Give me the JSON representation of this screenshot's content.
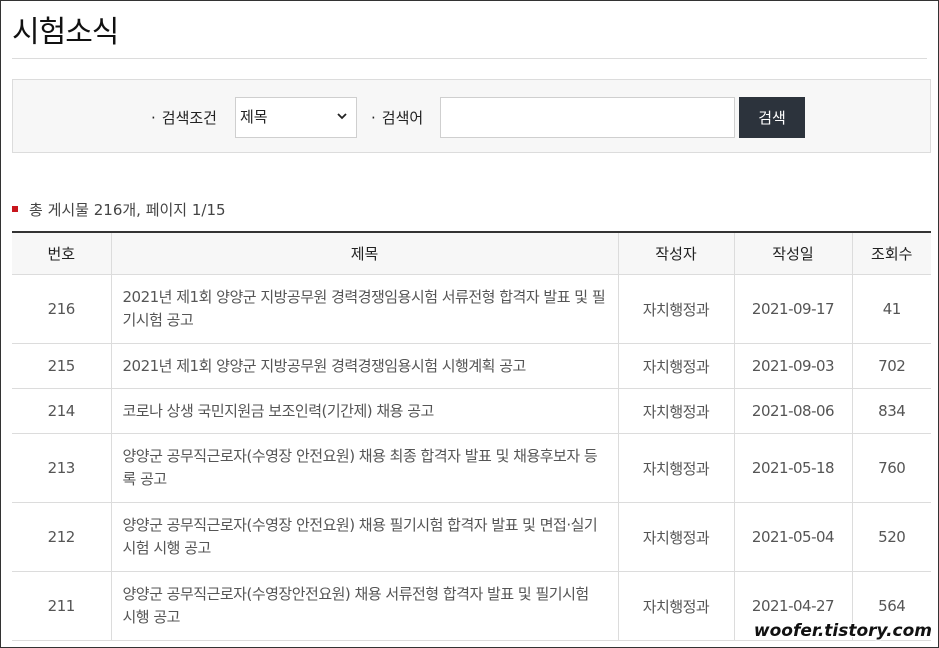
{
  "page": {
    "title": "시험소식"
  },
  "search": {
    "condition_label": "검색조건",
    "condition_selected": "제목",
    "keyword_label": "검색어",
    "keyword_value": "",
    "button_label": "검색"
  },
  "summary": {
    "text": "총 게시물 216개, 페이지 1/15"
  },
  "table": {
    "headers": [
      "번호",
      "제목",
      "작성자",
      "작성일",
      "조회수"
    ],
    "rows": [
      {
        "no": "216",
        "title": "2021년 제1회 양양군 지방공무원 경력경쟁임용시험 서류전형 합격자 발표 및 필기시험 공고",
        "author": "자치행정과",
        "date": "2021-09-17",
        "views": "41"
      },
      {
        "no": "215",
        "title": "2021년 제1회 양양군 지방공무원 경력경쟁임용시험 시행계획 공고",
        "author": "자치행정과",
        "date": "2021-09-03",
        "views": "702"
      },
      {
        "no": "214",
        "title": "코로나 상생 국민지원금 보조인력(기간제) 채용 공고",
        "author": "자치행정과",
        "date": "2021-08-06",
        "views": "834"
      },
      {
        "no": "213",
        "title": "양양군 공무직근로자(수영장 안전요원) 채용 최종 합격자 발표 및 채용후보자 등록 공고",
        "author": "자치행정과",
        "date": "2021-05-18",
        "views": "760"
      },
      {
        "no": "212",
        "title": "양양군 공무직근로자(수영장 안전요원) 채용 필기시험 합격자 발표 및 면접·실기시험 시행 공고",
        "author": "자치행정과",
        "date": "2021-05-04",
        "views": "520"
      },
      {
        "no": "211",
        "title": "양양군 공무직근로자(수영장안전요원) 채용 서류전형 합격자 발표 및 필기시험 시행 공고",
        "author": "자치행정과",
        "date": "2021-04-27",
        "views": "564"
      }
    ]
  },
  "watermark": "woofer.tistory.com"
}
